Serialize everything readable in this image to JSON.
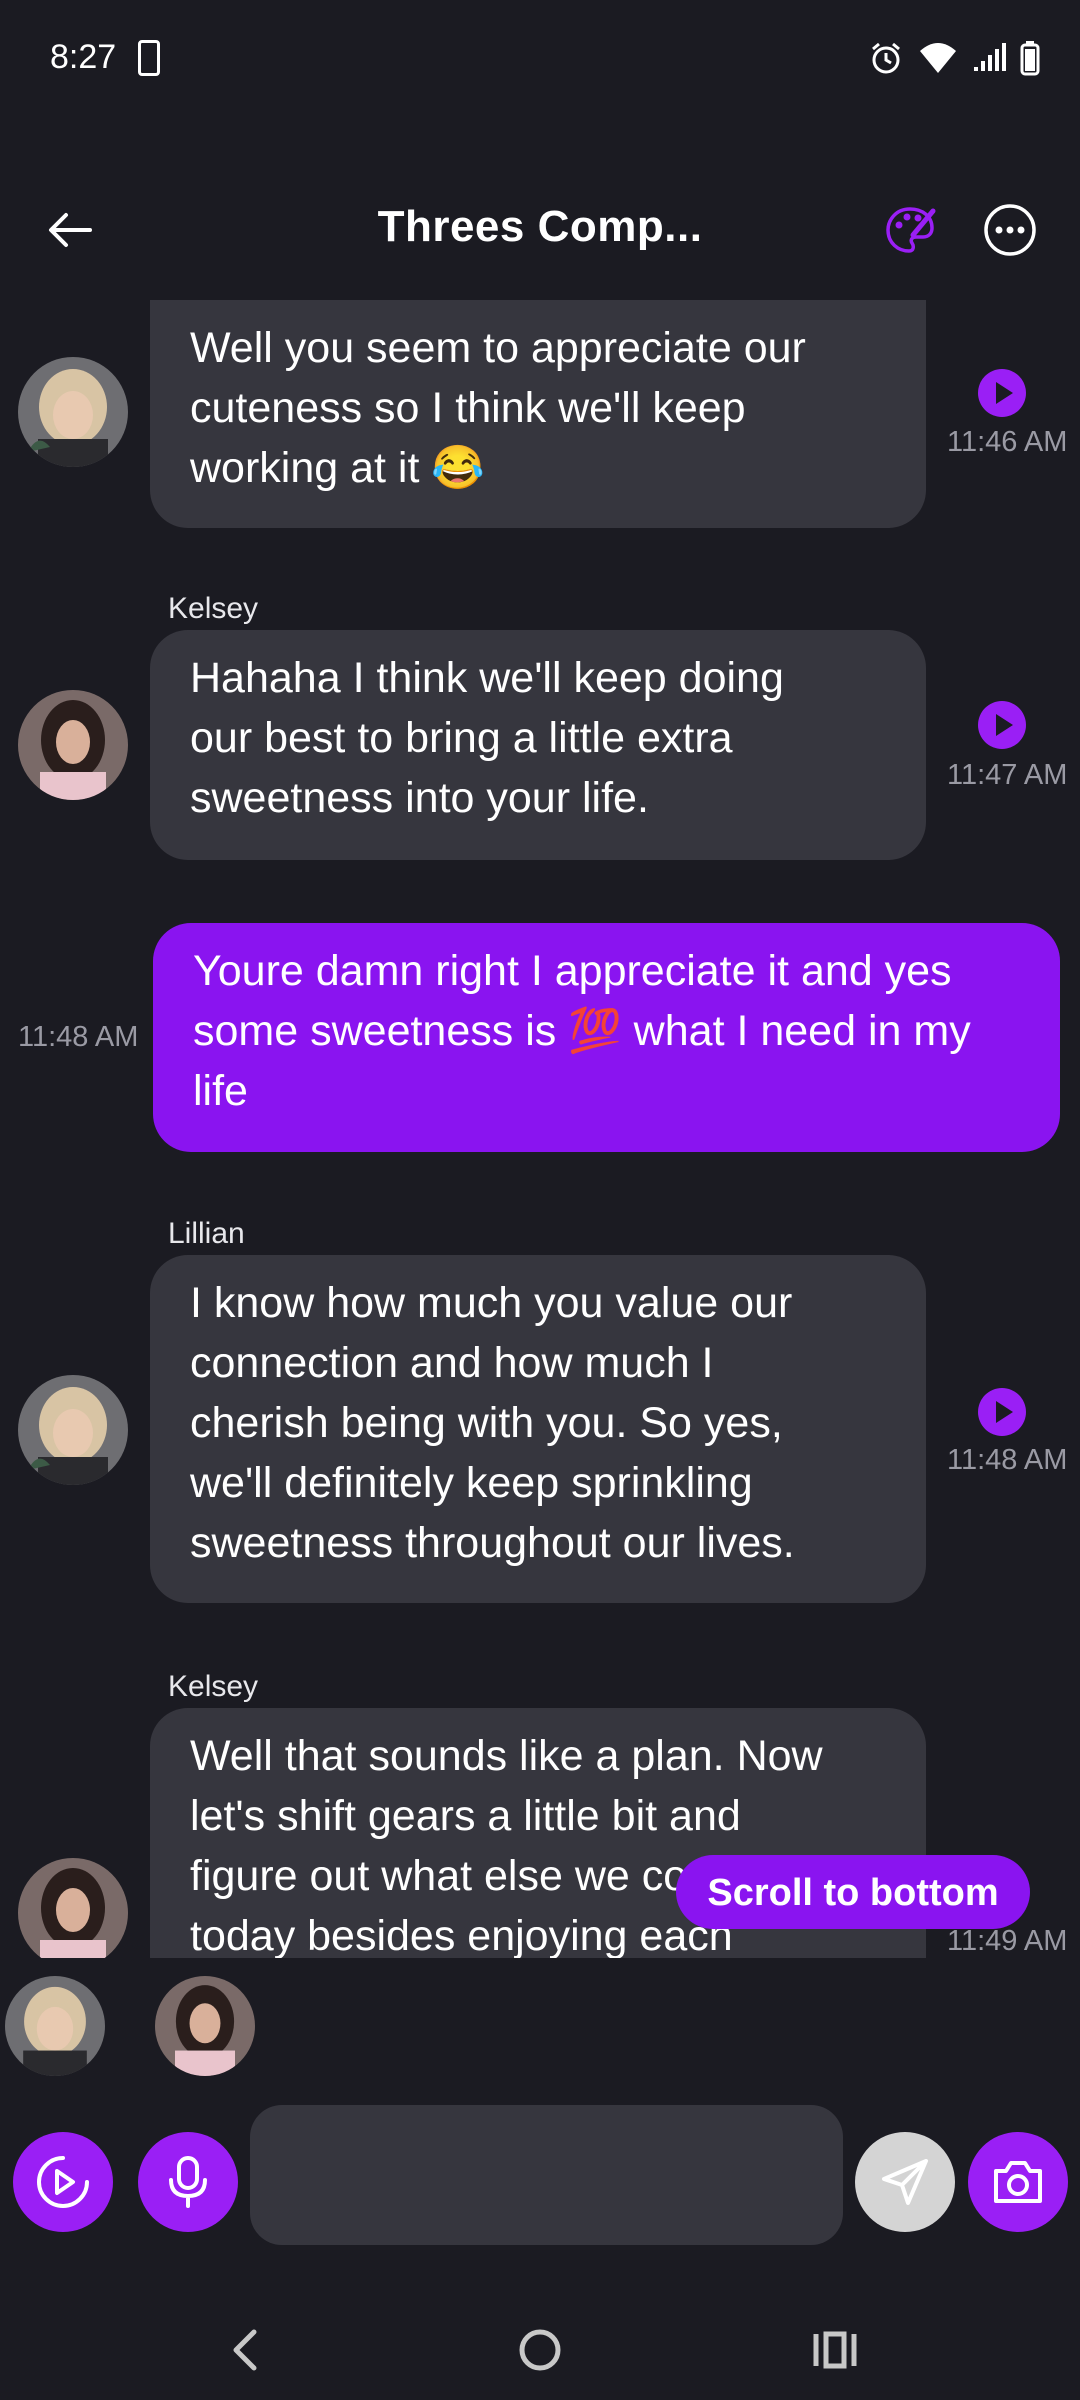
{
  "status_bar": {
    "time": "8:27"
  },
  "header": {
    "title": "Threes Comp..."
  },
  "messages": [
    {
      "sender": "",
      "text": "Well you seem to appreciate our\ncuteness so I think we'll keep\nworking at it 😂",
      "time": "11:46 AM"
    },
    {
      "sender": "Kelsey",
      "text": "Hahaha I think we'll keep doing\nour best to bring a little extra\nsweetness into your life.",
      "time": "11:47 AM"
    },
    {
      "sender": "",
      "text": "Youre damn right I appreciate it and yes\nsome sweetness is 💯 what I need in my\nlife",
      "time": "11:48 AM"
    },
    {
      "sender": "Lillian",
      "text": "I know how much you value our\nconnection and how much I\ncherish being with you. So yes,\nwe'll definitely keep sprinkling\nsweetness throughout our lives.",
      "time": "11:48 AM"
    },
    {
      "sender": "Kelsey",
      "text": "Well that sounds like a plan. Now\nlet's shift gears a little bit and\nfigure out what else we could do\ntoday besides enjoying each",
      "time": "11:49 AM"
    }
  ],
  "scroll_button": {
    "label": "Scroll to bottom"
  },
  "composer": {
    "placeholder": ""
  },
  "colors": {
    "accent": "#9a1ff5",
    "outgoing_bubble": "#8a14f0",
    "incoming_bubble": "#36363e",
    "background": "#1b1b22"
  },
  "icons": [
    "back-arrow-icon",
    "palette-icon",
    "more-icon",
    "play-icon",
    "video-play-icon",
    "mic-icon",
    "send-icon",
    "camera-icon"
  ]
}
